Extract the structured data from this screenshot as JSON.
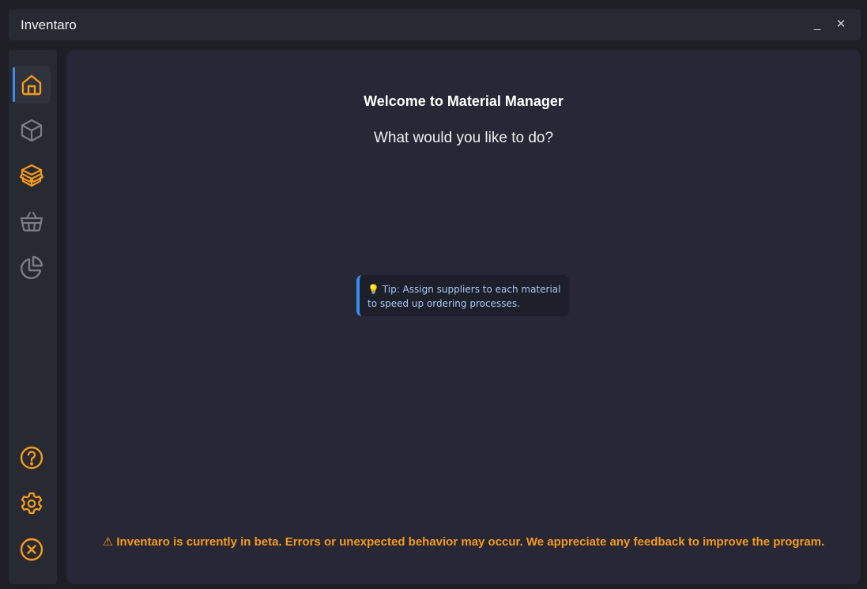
{
  "window": {
    "title": "Inventaro",
    "minimize_label": "_",
    "close_label": "✕"
  },
  "sidebar": {
    "top_items": [
      {
        "icon": "home-icon",
        "active": true,
        "color": "#f59a1b"
      },
      {
        "icon": "box-icon",
        "active": false,
        "color": "#7a7d84"
      },
      {
        "icon": "boxes-icon",
        "active": false,
        "color": "#f59a1b"
      },
      {
        "icon": "basket-icon",
        "active": false,
        "color": "#7a7d84"
      },
      {
        "icon": "pie-chart-icon",
        "active": false,
        "color": "#7a7d84"
      }
    ],
    "bottom_items": [
      {
        "icon": "help-icon",
        "color": "#f59a1b"
      },
      {
        "icon": "gear-icon",
        "color": "#f59a1b"
      },
      {
        "icon": "close-circle-icon",
        "color": "#f59a1b"
      }
    ]
  },
  "main": {
    "welcome_title": "Welcome to Material Manager",
    "question": "What would you like to do?",
    "tip": {
      "icon": "lightbulb-icon",
      "emoji": "💡",
      "text": "Tip: Assign suppliers to each material to speed up ordering processes."
    },
    "beta_notice": {
      "icon": "warning-icon",
      "symbol": "⚠",
      "text": "Inventaro is currently in beta. Errors or unexpected behavior may occur. We appreciate any feedback to improve the program."
    }
  },
  "colors": {
    "accent": "#f59a1b",
    "active_indicator": "#3b8cf0",
    "muted_icon": "#7a7d84",
    "tip_text": "#a9c9f5"
  }
}
